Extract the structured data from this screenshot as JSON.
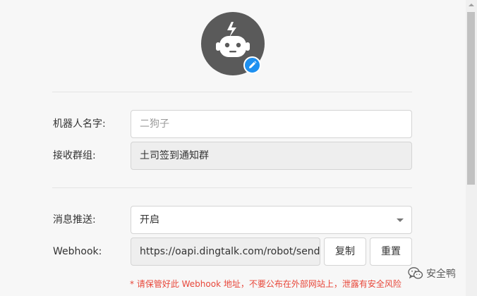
{
  "avatar": {
    "icon": "robot-icon",
    "badge_icon": "pencil-icon",
    "badge_color": "#1e90f0"
  },
  "form": {
    "robot_name": {
      "label": "机器人名字:",
      "placeholder": "二狗子"
    },
    "group": {
      "label": "接收群组:",
      "value": "土司签到通知群"
    },
    "push": {
      "label": "消息推送:",
      "value": "开启"
    },
    "webhook": {
      "label": "Webhook:",
      "value": "https://oapi.dingtalk.com/robot/send",
      "copy_label": "复制",
      "reset_label": "重置"
    },
    "warning": "* 请保管好此 Webhook 地址，不要公布在外部网站上，泄露有安全风险"
  },
  "watermark": {
    "text": "安全鸭",
    "icon": "wechat-icon"
  },
  "colors": {
    "accent": "#1e90f0",
    "warning": "#e8473a",
    "avatar_bg": "#5a5a5a"
  }
}
